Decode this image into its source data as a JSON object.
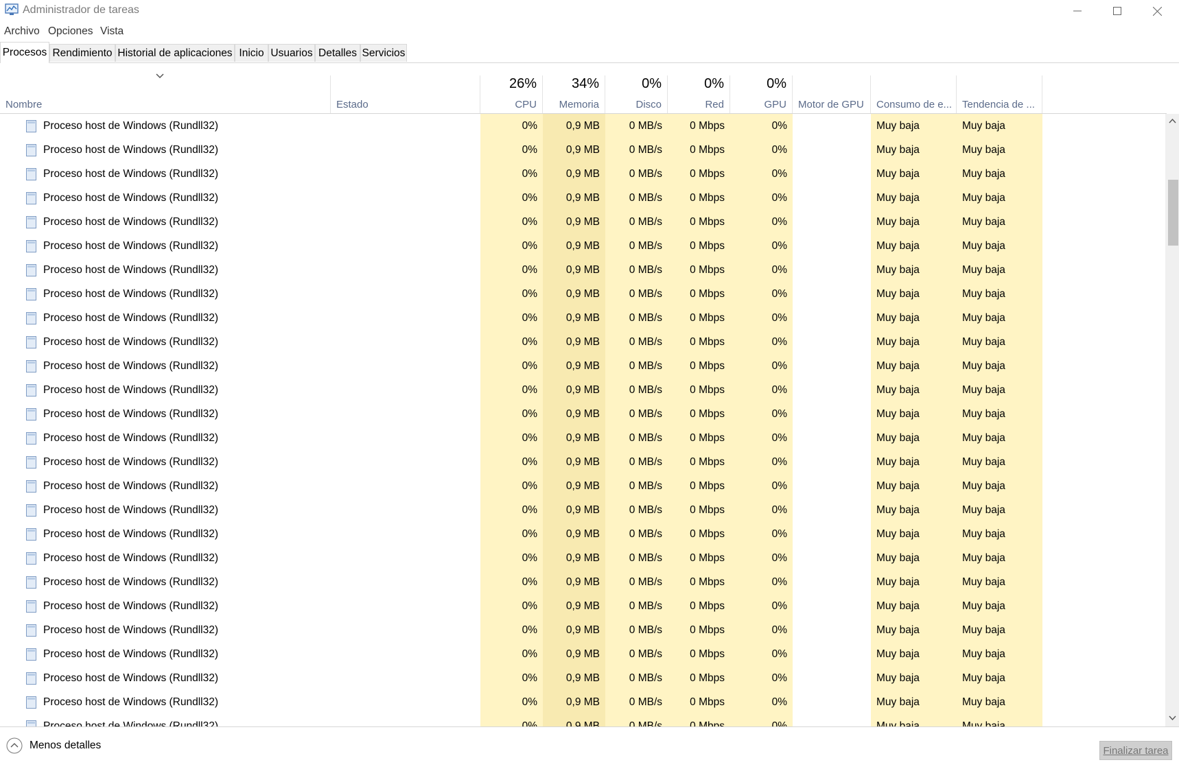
{
  "window": {
    "title": "Administrador de tareas",
    "controls": {
      "minimize": "minimize-icon",
      "maximize": "maximize-icon",
      "close": "close-icon"
    }
  },
  "menu": [
    "Archivo",
    "Opciones",
    "Vista"
  ],
  "tabs": [
    {
      "label": "Procesos",
      "active": true
    },
    {
      "label": "Rendimiento",
      "active": false
    },
    {
      "label": "Historial de aplicaciones",
      "active": false
    },
    {
      "label": "Inicio",
      "active": false
    },
    {
      "label": "Usuarios",
      "active": false
    },
    {
      "label": "Detalles",
      "active": false
    },
    {
      "label": "Servicios",
      "active": false
    }
  ],
  "columns": {
    "name": {
      "label": "Nombre"
    },
    "status": {
      "label": "Estado"
    },
    "cpu": {
      "label": "CPU",
      "summary": "26%"
    },
    "memory": {
      "label": "Memoria",
      "summary": "34%"
    },
    "disk": {
      "label": "Disco",
      "summary": "0%"
    },
    "network": {
      "label": "Red",
      "summary": "0%"
    },
    "gpu": {
      "label": "GPU",
      "summary": "0%"
    },
    "gpu_engine": {
      "label": "Motor de GPU"
    },
    "power": {
      "label": "Consumo de e..."
    },
    "power_trend": {
      "label": "Tendencia de ..."
    }
  },
  "process_row": {
    "name": "Proceso host de Windows (Rundll32)",
    "status": "",
    "cpu": "0%",
    "memory": "0,9 MB",
    "disk": "0 MB/s",
    "network": "0 Mbps",
    "gpu": "0%",
    "gpu_engine": "",
    "power": "Muy baja",
    "power_trend": "Muy baja",
    "visible_count": 25
  },
  "footer": {
    "less_details": "Menos detalles",
    "end_task": "Finalizar tarea"
  },
  "colors": {
    "heat_light": "#fff4c4",
    "heat_memory": "#f8eab1",
    "header_label": "#5b6b8a"
  }
}
